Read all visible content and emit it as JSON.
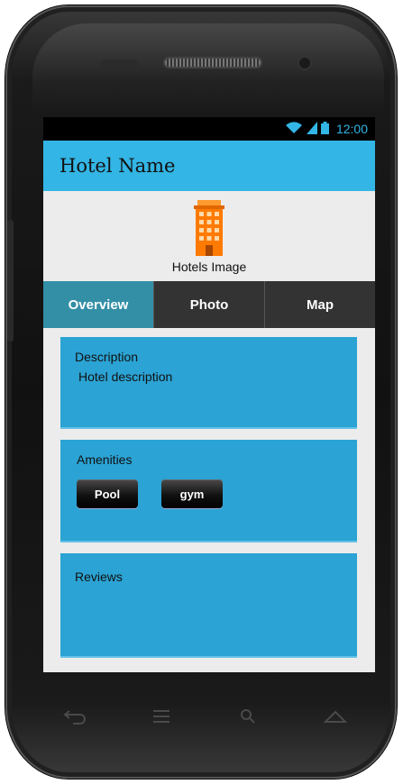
{
  "status_bar": {
    "icons": [
      "wifi-icon",
      "signal-icon",
      "battery-icon"
    ],
    "time": "12:00"
  },
  "app_bar": {
    "title": "Hotel Name"
  },
  "hero": {
    "icon": "building-icon",
    "caption": "Hotels Image"
  },
  "tabs": [
    {
      "label": "Overview",
      "active": true
    },
    {
      "label": "Photo",
      "active": false
    },
    {
      "label": "Map",
      "active": false
    }
  ],
  "description": {
    "heading": "Description",
    "text": "Hotel description"
  },
  "amenities": {
    "heading": "Amenities",
    "items": [
      "Pool",
      "gym"
    ]
  },
  "reviews": {
    "heading": "Reviews"
  },
  "nav_bar": {
    "icons": [
      "back-icon",
      "menu-icon",
      "search-icon",
      "home-icon"
    ]
  },
  "colors": {
    "accent": "#33b5e5",
    "card": "#2ba3d4",
    "active_tab": "#338fa6",
    "tab_bar": "#333333"
  }
}
